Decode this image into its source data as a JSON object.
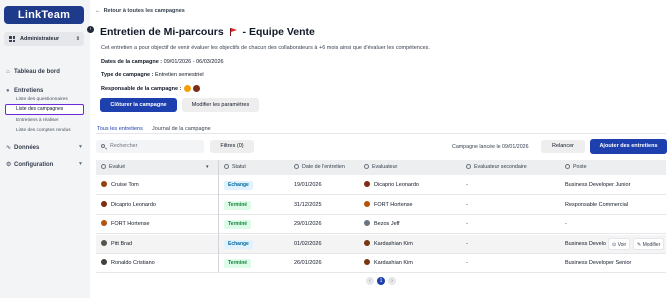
{
  "sidebar": {
    "logo": "LinkTeam",
    "collapse_icon": "chevron-left-icon",
    "role_selector": "Administrateur",
    "nav": {
      "home": "Tableau de bord",
      "interviews": "Entretiens",
      "data": "Données",
      "config": "Configuration"
    },
    "interview_sub": [
      "Liste des questionnaires",
      "Liste des campagnes",
      "Entretiens à réaliser",
      "Liste des comptes rendus"
    ]
  },
  "header": {
    "back_link": "Retour à toutes les campagnes",
    "title_part1": "Entretien de Mi-parcours",
    "title_part2": "- Equipe Vente",
    "description": "Cet entretien a pour objectif de venir évaluer les objectifs de chacun des collaborateurs à +6 mois ainsi que d'évaluer les compétences.",
    "dates_label": "Dates de la campagne :",
    "dates_value": "09/01/2026 - 06/03/2026",
    "type_label": "Type de campagne :",
    "type_value": "Entretien semestriel",
    "manager_label": "Responsable de la campagne :",
    "close_button": "Clôturer la campagne",
    "edit_button": "Modifier les paramètres"
  },
  "tabs": [
    "Tous les entretiens",
    "Journal de la campagne"
  ],
  "toolbar": {
    "search_placeholder": "Rechercher",
    "filters_button": "Filtres (0)",
    "campaign_note": "Campagne lancée le 09/01/2026",
    "remind_button": "Relancer",
    "add_button": "Ajouter des entretiens"
  },
  "table": {
    "columns": [
      "Evalué",
      "Statut",
      "Date de l'entretien",
      "Evaluateur",
      "Evaluateur secondaire",
      "Poste"
    ],
    "rows": [
      {
        "evalue": "Cruise Tom",
        "statut": "Echange",
        "date": "19/01/2026",
        "evaluateur": "Dicaprio Leonardo",
        "secondaire": "-",
        "poste": "Business Developer Junior"
      },
      {
        "evalue": "Dicaprio Leonardo",
        "statut": "Terminé",
        "date": "31/12/2025",
        "evaluateur": "FORT Hortense",
        "secondaire": "-",
        "poste": "Responsable Commercial"
      },
      {
        "evalue": "FORT Hortense",
        "statut": "Terminé",
        "date": "29/01/2026",
        "evaluateur": "Bezos Jeff",
        "secondaire": "-",
        "poste": "-"
      },
      {
        "evalue": "Pitt Brad",
        "statut": "Echange",
        "date": "01/02/2026",
        "evaluateur": "Kardashian Kim",
        "secondaire": "-",
        "poste": "Business Develo"
      },
      {
        "evalue": "Ronaldo Cristiano",
        "statut": "Terminé",
        "date": "26/01/2026",
        "evaluateur": "Kardashian Kim",
        "secondaire": "-",
        "poste": "Business Developer Senior"
      }
    ],
    "row_actions": [
      "Voir",
      "Modifier"
    ]
  },
  "pagination": {
    "current": "1"
  },
  "colors": {
    "primary": "#1e40af",
    "echange_badge": "#0369a1",
    "termine_badge": "#15803d"
  }
}
